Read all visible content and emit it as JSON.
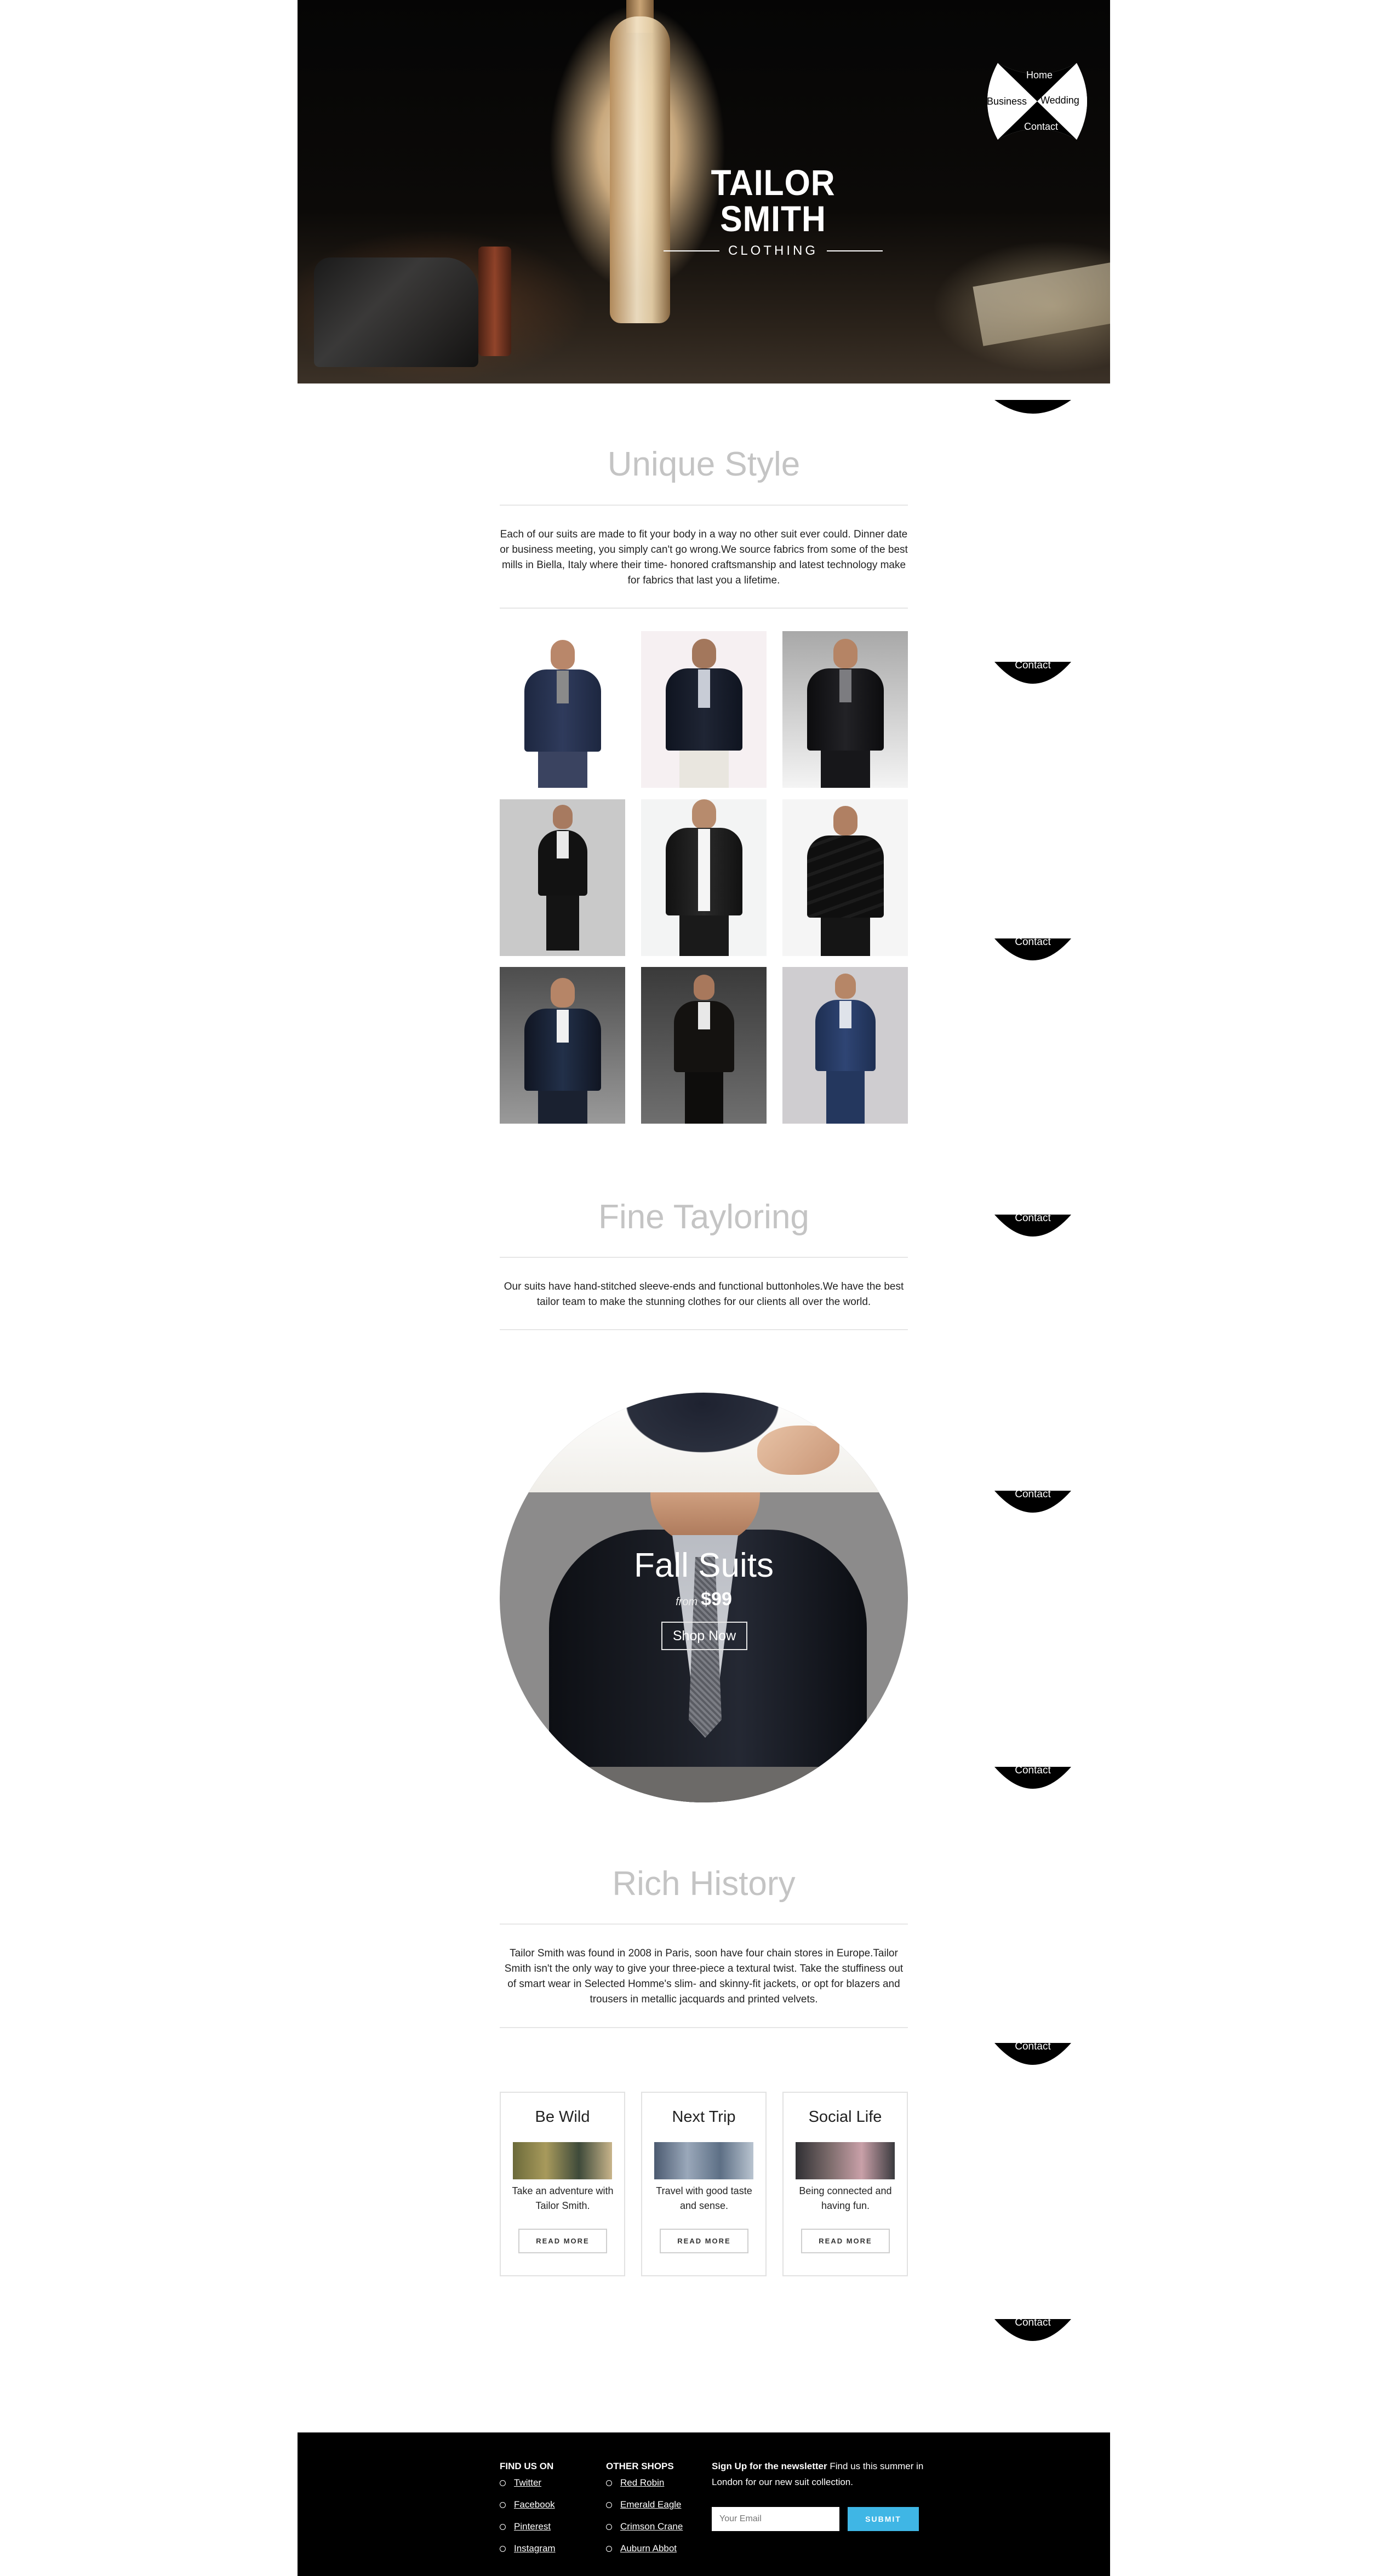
{
  "brand": {
    "name": "TAILOR SMITH",
    "sub": "CLOTHING"
  },
  "nav": {
    "home": "Home",
    "business": "Business",
    "wedding": "Wedding",
    "contact": "Contact"
  },
  "side_tab": {
    "label": "Contact"
  },
  "unique": {
    "title": "Unique Style",
    "text": "Each of our suits are made to fit your body in a way no other suit ever could. Dinner date or business meeting, you simply can't go wrong.We source fabrics from some of the best mills in Biella, Italy where their time- honored craftsmanship and latest technology make for fabrics that last you a lifetime."
  },
  "fine": {
    "title": "Fine Tayloring",
    "text": "Our suits have hand-stitched sleeve-ends and functional buttonholes.We have the best tailor team to make the stunning clothes for our clients all over the world."
  },
  "promo": {
    "title": "Fall Suits",
    "from": "from",
    "price": "$99",
    "button": "Shop Now"
  },
  "history": {
    "title": "Rich History",
    "text": "Tailor Smith was found in 2008 in Paris, soon have four chain stores in Europe.Tailor Smith isn't the only way to give your three-piece a textural twist. Take the stuffiness out of smart wear in Selected Homme's slim- and skinny-fit jackets, or opt for blazers and trousers in metallic jacquards and printed velvets."
  },
  "cards": [
    {
      "title": "Be Wild",
      "text": "Take an adventure with Tailor Smith.",
      "button": "READ MORE"
    },
    {
      "title": "Next Trip",
      "text": "Travel with good taste and sense.",
      "button": "READ MORE"
    },
    {
      "title": "Social Life",
      "text": "Being connected and having fun.",
      "button": "READ MORE"
    }
  ],
  "footer": {
    "find_us_title": "FIND US ON",
    "find_us": [
      "Twitter",
      "Facebook",
      "Pinterest",
      "Instagram"
    ],
    "shops_title": "OTHER SHOPS",
    "shops": [
      "Red Robin",
      "Emerald Eagle",
      "Crimson Crane",
      "Auburn Abbot"
    ],
    "newsletter_bold": "Sign Up for the newsletter",
    "newsletter_text": " Find us this summer in London for our new suit collection.",
    "email_placeholder": "Your Email",
    "submit": "SUBMIT"
  },
  "colors": {
    "accent": "#3fb6e5",
    "heading_gray": "#c4c4c4",
    "footer_bg": "#000000"
  },
  "icons": {
    "product_images": "suit-photo",
    "card_images": "lifestyle-photo"
  }
}
